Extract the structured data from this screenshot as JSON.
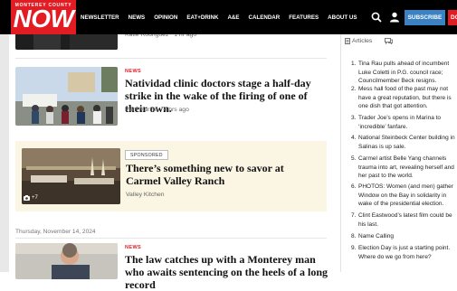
{
  "brand": {
    "logo_top": "MONTEREY COUNTY",
    "logo_main": "NOW",
    "accent_red": "#e31b23",
    "accent_blue": "#3b82c4"
  },
  "nav": {
    "items": [
      "NEWSLETTER",
      "NEWS",
      "OPINION",
      "EAT+DRINK",
      "A&E",
      "CALENDAR",
      "FEATURES",
      "ABOUT US"
    ],
    "subscribe_label": "SUBSCRIBE",
    "donate_label": "DO"
  },
  "feed": {
    "top_byline": {
      "author": "Katie Rodriguez",
      "time": "1 hr ago"
    },
    "story1": {
      "section": "NEWS",
      "headline": "Natividad clinic doctors stage a half-day strike in the wake of the firing of one of their own.",
      "author": "Pam Marino",
      "time": "4 hrs ago"
    },
    "sponsored": {
      "label": "SPONSORED",
      "headline": "There’s something new to savor at Carmel Valley Ranch",
      "advertiser": "Valley Kitchen",
      "gallery_count": "+7"
    },
    "date_divider": "Thursday, November 14, 2024",
    "story2": {
      "section": "NEWS",
      "headline": "The law catches up with a Monterey man who awaits sentencing on the heels of a long record"
    }
  },
  "sidebar": {
    "tabs": [
      "Articles",
      ""
    ],
    "trending": [
      "Tina Rau pulls ahead of incumbent Luke Coletti in P.G. council race; Councilmember Beck resigns.",
      "Mess hall food of the past may not have a great reputation, but there is one dish that got attention.",
      "Trader Joe’s opens in Marina to ‘incredible’ fanfare.",
      "National Steinbeck Center building in Salinas is up sale.",
      "Carmel artist Belle Yang channels trauma into art, revealing herself and her past to the world.",
      "PHOTOS: Women (and men) gather Window on the Bay in solidarity in wake of the presidential election.",
      "Clint Eastwood’s latest film could be his last.",
      "Name Calling",
      "Election Day is just a starting point. Where do we go from here?"
    ]
  }
}
